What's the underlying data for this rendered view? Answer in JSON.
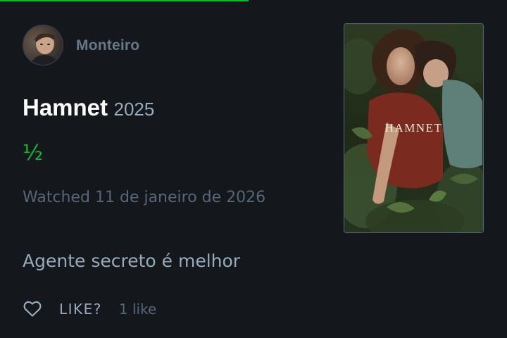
{
  "review": {
    "username": "Monteiro",
    "film_title": "Hamnet",
    "film_year": "2025",
    "rating_text": "½",
    "rating_stars": 0.5,
    "watched_text": "Watched 11 de janeiro de 2026",
    "review_text": "Agente secreto é melhor",
    "like_label": "LIKE?",
    "like_count": "1 like"
  },
  "poster": {
    "title": "HAMNET"
  },
  "icons": {
    "avatar": "user-avatar",
    "like": "heart-outline-icon"
  },
  "colors": {
    "background": "#14181c",
    "accent_green": "#00c030",
    "title": "#ffffff",
    "muted": "#566677",
    "text": "#99aabb"
  },
  "loading_progress": 0.49
}
